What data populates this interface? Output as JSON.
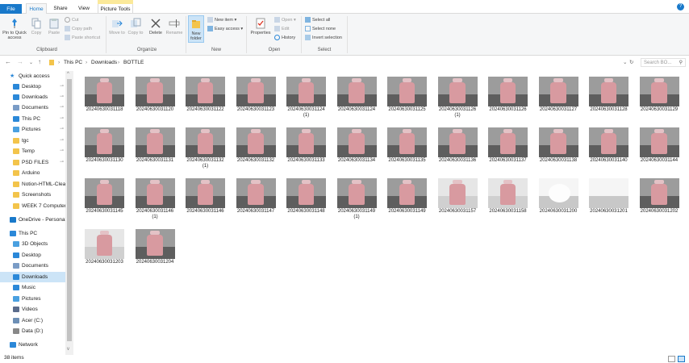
{
  "ribbon_tabs": {
    "file": "File",
    "home": "Home",
    "share": "Share",
    "view": "View",
    "picture_tools": "Picture Tools"
  },
  "ribbon": {
    "clipboard": {
      "pin": "Pin to Quick access",
      "copy": "Copy",
      "paste": "Paste",
      "cut": "Cut",
      "copy_path": "Copy path",
      "paste_shortcut": "Paste shortcut",
      "label": "Clipboard"
    },
    "organize": {
      "move": "Move to",
      "copy_to": "Copy to",
      "delete": "Delete",
      "rename": "Rename",
      "label": "Organize"
    },
    "new": {
      "new_folder": "New folder",
      "new_item": "New item",
      "easy_access": "Easy access",
      "label": "New"
    },
    "open": {
      "properties": "Properties",
      "open": "Open",
      "edit": "Edit",
      "history": "History",
      "label": "Open"
    },
    "select": {
      "select_all": "Select all",
      "select_none": "Select none",
      "invert": "Invert selection",
      "label": "Select"
    }
  },
  "address": {
    "crumbs": [
      "This PC",
      "Downloads",
      "BOTTLE"
    ],
    "search_placeholder": "Search BO..."
  },
  "nav": [
    {
      "label": "Quick access",
      "icon": "star-icon",
      "color": "#2b88d8",
      "pinned": false
    },
    {
      "label": "Desktop",
      "icon": "desktop-icon",
      "color": "#2b88d8",
      "pinned": true
    },
    {
      "label": "Downloads",
      "icon": "download-icon",
      "color": "#2b88d8",
      "pinned": true
    },
    {
      "label": "Documents",
      "icon": "documents-icon",
      "color": "#7a9cc6",
      "pinned": true
    },
    {
      "label": "This PC",
      "icon": "computer-icon",
      "color": "#2b88d8",
      "pinned": true
    },
    {
      "label": "Pictures",
      "icon": "pictures-icon",
      "color": "#4aa0e0",
      "pinned": true
    },
    {
      "label": "tgc",
      "icon": "folder-icon",
      "color": "#f3c44b",
      "pinned": true
    },
    {
      "label": "Temp",
      "icon": "folder-icon",
      "color": "#f3c44b",
      "pinned": true
    },
    {
      "label": "PSD FILES",
      "icon": "folder-icon",
      "color": "#f3c44b",
      "pinned": true
    },
    {
      "label": "Arduino",
      "icon": "folder-icon",
      "color": "#f3c44b",
      "pinned": false
    },
    {
      "label": "Notion-HTML-Cleaner",
      "icon": "folder-icon",
      "color": "#f3c44b",
      "pinned": false
    },
    {
      "label": "Screenshots",
      "icon": "folder-icon",
      "color": "#f3c44b",
      "pinned": false
    },
    {
      "label": "WEEK 7 Computer",
      "icon": "folder-icon",
      "color": "#f3c44b",
      "pinned": false
    },
    {
      "label": "OneDrive - Personal",
      "icon": "cloud-icon",
      "color": "#1979ca",
      "pinned": false
    },
    {
      "label": "This PC",
      "icon": "computer-icon",
      "color": "#2b88d8",
      "pinned": false
    },
    {
      "label": "3D Objects",
      "icon": "cube-icon",
      "color": "#4aa0e0",
      "pinned": false
    },
    {
      "label": "Desktop",
      "icon": "desktop-icon",
      "color": "#2b88d8",
      "pinned": false
    },
    {
      "label": "Documents",
      "icon": "documents-icon",
      "color": "#7a9cc6",
      "pinned": false
    },
    {
      "label": "Downloads",
      "icon": "download-icon",
      "color": "#2b88d8",
      "pinned": false,
      "selected": true
    },
    {
      "label": "Music",
      "icon": "music-icon",
      "color": "#2b88d8",
      "pinned": false
    },
    {
      "label": "Pictures",
      "icon": "pictures-icon",
      "color": "#4aa0e0",
      "pinned": false
    },
    {
      "label": "Videos",
      "icon": "videos-icon",
      "color": "#5a6c8c",
      "pinned": false
    },
    {
      "label": "Acer (C:)",
      "icon": "drive-icon",
      "color": "#6d8fb5",
      "pinned": false
    },
    {
      "label": "Data (D:)",
      "icon": "drive-icon",
      "color": "#888888",
      "pinned": false
    },
    {
      "label": "Network",
      "icon": "network-icon",
      "color": "#2b88d8",
      "pinned": false
    }
  ],
  "files": [
    {
      "name": "20240630031118",
      "suffix": "",
      "style": "dark"
    },
    {
      "name": "20240630031120",
      "suffix": "",
      "style": "dark"
    },
    {
      "name": "20240630031122",
      "suffix": "",
      "style": "dark"
    },
    {
      "name": "20240630031123",
      "suffix": "",
      "style": "dark"
    },
    {
      "name": "20240630031124",
      "suffix": "(1)",
      "style": "dark"
    },
    {
      "name": "20240630031124",
      "suffix": "",
      "style": "dark"
    },
    {
      "name": "20240630031125",
      "suffix": "",
      "style": "dark"
    },
    {
      "name": "20240630031126",
      "suffix": "(1)",
      "style": "dark"
    },
    {
      "name": "20240630031126",
      "suffix": "",
      "style": "dark"
    },
    {
      "name": "20240630031127",
      "suffix": "",
      "style": "dark"
    },
    {
      "name": "20240630031128",
      "suffix": "",
      "style": "dark"
    },
    {
      "name": "20240630031129",
      "suffix": "",
      "style": "dark"
    },
    {
      "name": "20240630031130",
      "suffix": "",
      "style": "dark"
    },
    {
      "name": "20240630031131",
      "suffix": "",
      "style": "dark"
    },
    {
      "name": "20240630031132",
      "suffix": "(1)",
      "style": "dark"
    },
    {
      "name": "20240630031132",
      "suffix": "",
      "style": "dark"
    },
    {
      "name": "20240630031133",
      "suffix": "",
      "style": "dark"
    },
    {
      "name": "20240630031134",
      "suffix": "",
      "style": "dark"
    },
    {
      "name": "20240630031135",
      "suffix": "",
      "style": "dark"
    },
    {
      "name": "20240630031136",
      "suffix": "",
      "style": "dark"
    },
    {
      "name": "20240630031137",
      "suffix": "",
      "style": "dark"
    },
    {
      "name": "20240630031138",
      "suffix": "",
      "style": "dark"
    },
    {
      "name": "20240630031140",
      "suffix": "",
      "style": "dark"
    },
    {
      "name": "20240630031144",
      "suffix": "",
      "style": "dark"
    },
    {
      "name": "20240630031145",
      "suffix": "",
      "style": "dark"
    },
    {
      "name": "20240630031146",
      "suffix": "(1)",
      "style": "dark"
    },
    {
      "name": "20240630031146",
      "suffix": "",
      "style": "dark"
    },
    {
      "name": "20240630031147",
      "suffix": "",
      "style": "dark"
    },
    {
      "name": "20240630031148",
      "suffix": "",
      "style": "dark"
    },
    {
      "name": "20240630031149",
      "suffix": "(1)",
      "style": "dark"
    },
    {
      "name": "20240630031149",
      "suffix": "",
      "style": "dark"
    },
    {
      "name": "20240630031157",
      "suffix": "",
      "style": "light"
    },
    {
      "name": "20240630031158",
      "suffix": "",
      "style": "light"
    },
    {
      "name": "20240630031200",
      "suffix": "",
      "style": "glow"
    },
    {
      "name": "20240630031201",
      "suffix": "",
      "style": "blank"
    },
    {
      "name": "20240630031202",
      "suffix": "",
      "style": "dark"
    },
    {
      "name": "20240630031203",
      "suffix": "",
      "style": "light"
    },
    {
      "name": "20240630031204",
      "suffix": "",
      "style": "dark"
    }
  ],
  "status": {
    "count": "38 items"
  },
  "colors": {
    "accent": "#1979ca",
    "selected": "#cce4f7",
    "pink": "#d89aa0"
  }
}
